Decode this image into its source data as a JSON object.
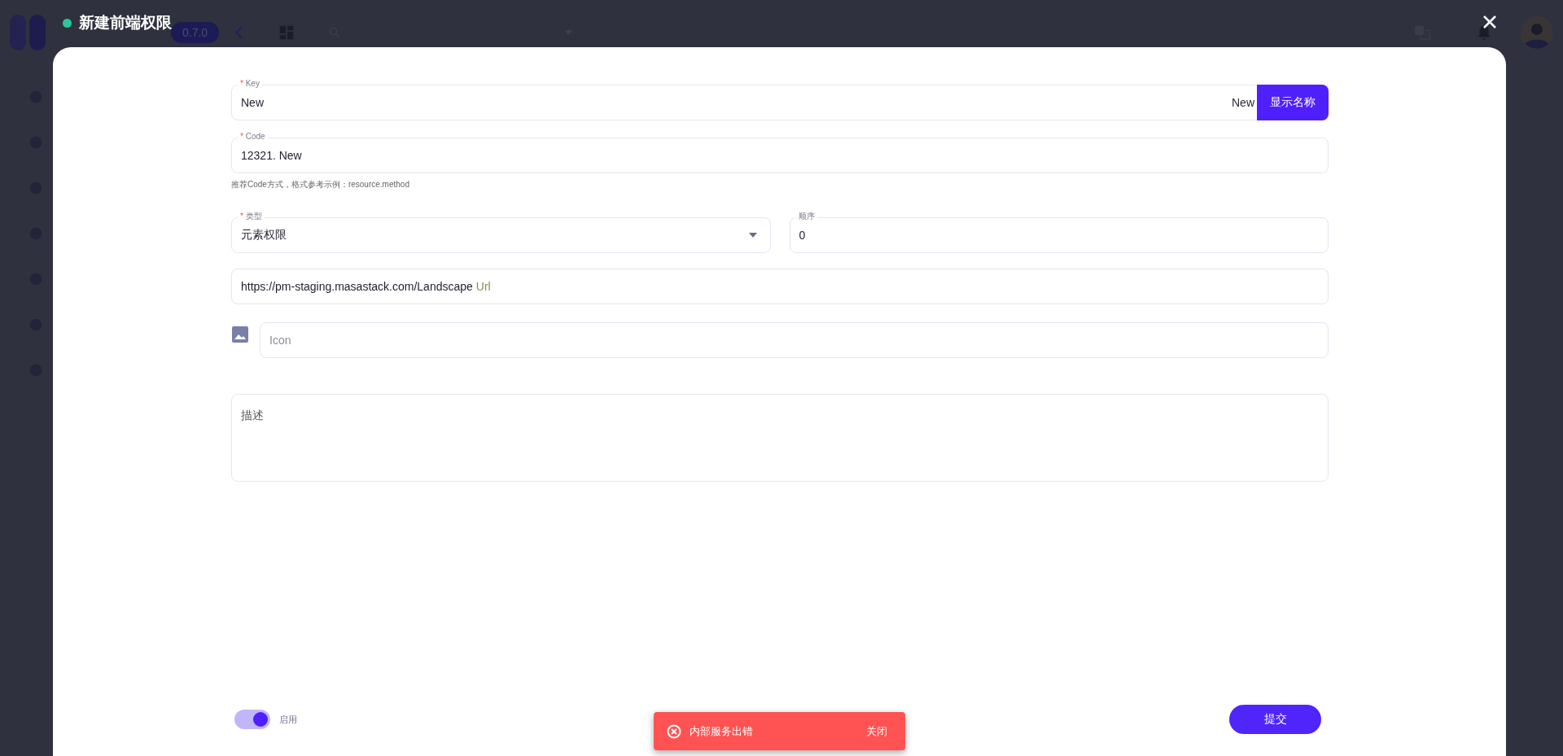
{
  "background": {
    "version": "0.7.0"
  },
  "dialog": {
    "title": "新建前端权限",
    "key_field": {
      "label": "Key",
      "required_mark": "*",
      "value": "New",
      "suffix": "New",
      "button": "显示名称"
    },
    "code_field": {
      "label": "Code",
      "required_mark": "*",
      "value": "12321. New",
      "hint": "推荐Code方式，格式参考示例：resource.method"
    },
    "type_field": {
      "label": "类型",
      "required_mark": "*",
      "value": "元素权限"
    },
    "order_field": {
      "label": "顺序",
      "value": "0"
    },
    "url_field": {
      "value": "https://pm-staging.masastack.com/Landscape",
      "suffix": "Url"
    },
    "icon_field": {
      "placeholder": "Icon"
    },
    "description_field": {
      "placeholder": "描述"
    },
    "enabled_switch": {
      "label": "启用",
      "on": true
    },
    "submit_button": "提交"
  },
  "snackbar": {
    "message": "内部服务出错",
    "action": "关闭"
  }
}
